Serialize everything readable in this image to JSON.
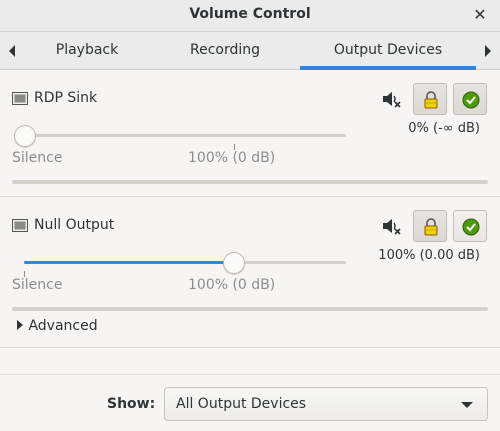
{
  "window": {
    "title": "Volume Control",
    "close_glyph": "✕"
  },
  "tabs": [
    {
      "label": "Playback",
      "active": false
    },
    {
      "label": "Recording",
      "active": false
    },
    {
      "label": "Output Devices",
      "active": true
    }
  ],
  "devices": [
    {
      "name": "RDP Sink",
      "volume_text": "0% (-∞ dB)",
      "volume_fraction": 0.0,
      "scale_min_label": "Silence",
      "scale_mid_label": "100% (0 dB)",
      "muted": true,
      "locked": true,
      "is_default": true,
      "icon": "monitor-icon"
    },
    {
      "name": "Null Output",
      "volume_text": "100% (0.00 dB)",
      "volume_fraction": 1.0,
      "scale_min_label": "Silence",
      "scale_mid_label": "100% (0 dB)",
      "muted": true,
      "locked": true,
      "is_default": true,
      "icon": "monitor-icon"
    }
  ],
  "advanced": {
    "label": "Advanced",
    "expanded": false
  },
  "show": {
    "label": "Show:",
    "selected": "All Output Devices"
  },
  "colors": {
    "accent": "#3584e4",
    "default_check": "#4e9a06",
    "lock": "#c4a000"
  }
}
